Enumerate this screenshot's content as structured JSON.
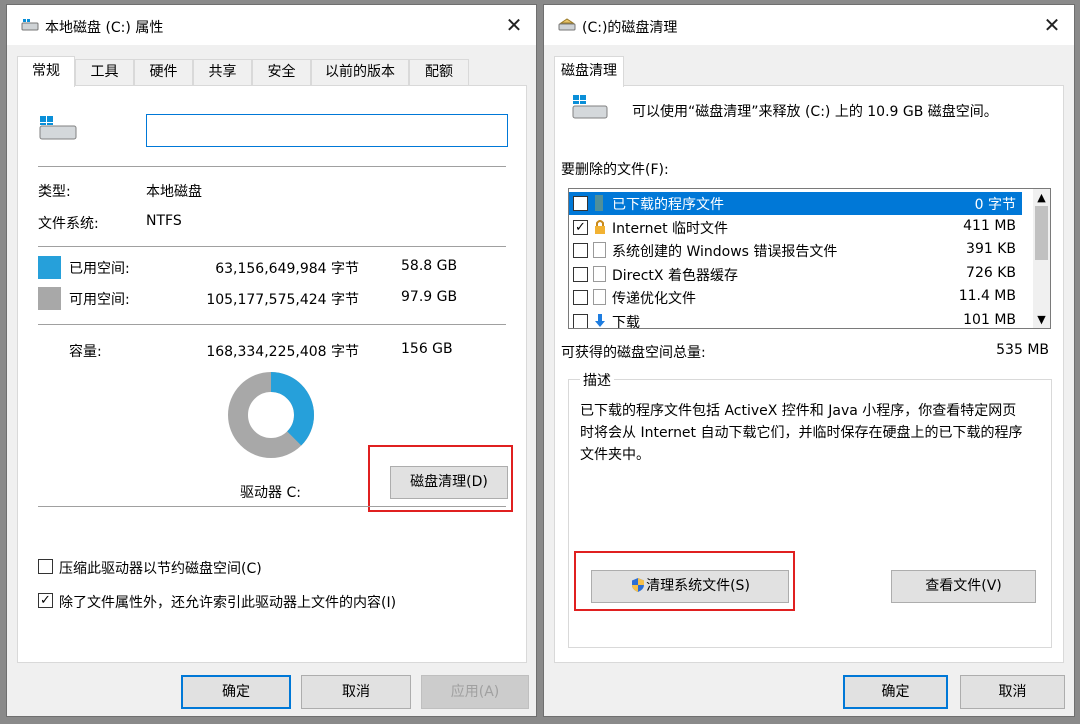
{
  "left_window": {
    "title": "本地磁盘 (C:) 属性",
    "close": "✕",
    "tabs": [
      "常规",
      "工具",
      "硬件",
      "共享",
      "安全",
      "以前的版本",
      "配额"
    ],
    "name_value": "",
    "type_label": "类型:",
    "type_value": "本地磁盘",
    "fs_label": "文件系统:",
    "fs_value": "NTFS",
    "used": {
      "label": "已用空间:",
      "bytes": "63,156,649,984 字节",
      "size": "58.8 GB",
      "color": "#26a0da"
    },
    "free": {
      "label": "可用空间:",
      "bytes": "105,177,575,424 字节",
      "size": "97.9 GB",
      "color": "#a8a8a8"
    },
    "capacity": {
      "label": "容量:",
      "bytes": "168,334,225,408 字节",
      "size": "156 GB"
    },
    "drive_label": "驱动器 C:",
    "cleanup_button": "磁盘清理(D)",
    "compress_option": "压缩此驱动器以节约磁盘空间(C)",
    "compress_checked": false,
    "index_option": "除了文件属性外，还允许索引此驱动器上文件的内容(I)",
    "index_checked": true,
    "ok_button": "确定",
    "cancel_button": "取消",
    "apply_button": "应用(A)"
  },
  "right_window": {
    "title": "(C:)的磁盘清理",
    "close": "✕",
    "tab": "磁盘清理",
    "intro": "可以使用“磁盘清理”来释放 (C:) 上的 10.9 GB 磁盘空间。",
    "files_label": "要删除的文件(F):",
    "files": [
      {
        "name": "已下载的程序文件",
        "size": "0 字节",
        "checked": true,
        "selected": true,
        "icon": "folder-icon"
      },
      {
        "name": "Internet 临时文件",
        "size": "411 MB",
        "checked": true,
        "selected": false,
        "icon": "lock-icon"
      },
      {
        "name": "系统创建的 Windows 错误报告文件",
        "size": "391 KB",
        "checked": false,
        "selected": false,
        "icon": "file-icon"
      },
      {
        "name": "DirectX 着色器缓存",
        "size": "726 KB",
        "checked": false,
        "selected": false,
        "icon": "file-icon"
      },
      {
        "name": "传递优化文件",
        "size": "11.4 MB",
        "checked": false,
        "selected": false,
        "icon": "file-icon"
      },
      {
        "name": "下载",
        "size": "101 MB",
        "checked": false,
        "selected": false,
        "icon": "download-icon"
      }
    ],
    "total_label": "可获得的磁盘空间总量:",
    "total_value": "535 MB",
    "desc_legend": "描述",
    "desc_text": "已下载的程序文件包括 ActiveX 控件和 Java 小程序，你查看特定网页时将会从 Internet 自动下载它们，并临时保存在硬盘上的已下载的程序文件夹中。",
    "clean_system_button": "清理系统文件(S)",
    "view_files_button": "查看文件(V)",
    "ok_button": "确定",
    "cancel_button": "取消"
  },
  "highlight_color": "#e02020",
  "accent_color": "#0078d7"
}
